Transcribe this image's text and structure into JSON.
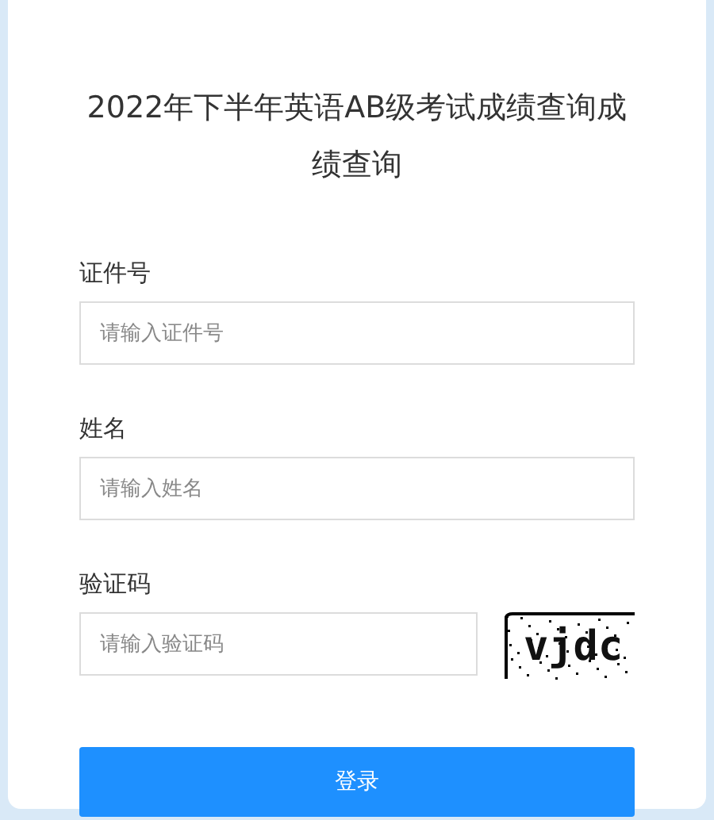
{
  "title": "2022年下半年英语AB级考试成绩查询成绩查询",
  "fields": [
    {
      "label": "证件号",
      "placeholder": "请输入证件号",
      "kind": "text"
    },
    {
      "label": "姓名",
      "placeholder": "请输入姓名",
      "kind": "text"
    },
    {
      "label": "验证码",
      "placeholder": "请输入验证码",
      "kind": "captcha",
      "captcha": "vjdc"
    }
  ],
  "submit": "登录"
}
